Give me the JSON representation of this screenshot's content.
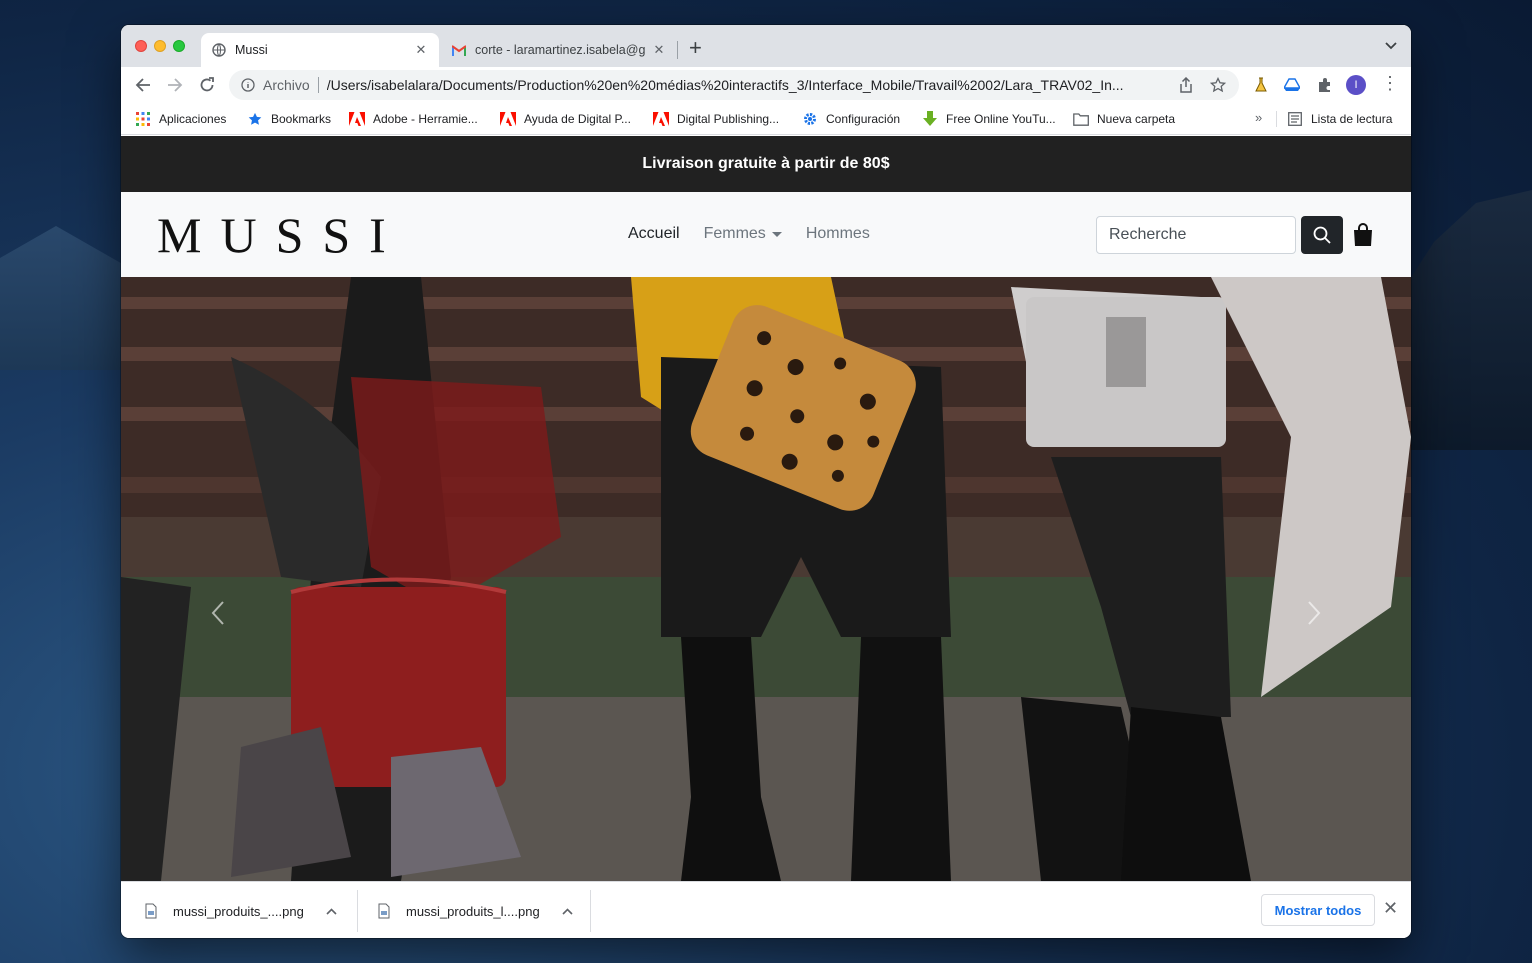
{
  "browser": {
    "tabs": [
      {
        "title": "Mussi",
        "icon": "globe-icon"
      },
      {
        "title": "corte - laramartinez.isabela@g",
        "icon": "gmail-icon"
      }
    ],
    "address": {
      "scheme": "Archivo",
      "url": "/Users/isabelalara/Documents/Production%20en%20médias%20interactifs_3/Interface_Mobile/Travail%2002/Lara_TRAV02_In..."
    },
    "bookmarks": [
      {
        "label": "Aplicaciones",
        "icon": "apps-grid-icon"
      },
      {
        "label": "Bookmarks",
        "icon": "star-icon"
      },
      {
        "label": "Adobe - Herramie...",
        "icon": "adobe-icon"
      },
      {
        "label": "Ayuda de Digital P...",
        "icon": "adobe-icon"
      },
      {
        "label": "Digital Publishing...",
        "icon": "adobe-icon"
      },
      {
        "label": "Configuración",
        "icon": "gear-icon"
      },
      {
        "label": "Free Online YouTu...",
        "icon": "download-arrow-icon"
      },
      {
        "label": "Nueva carpeta",
        "icon": "folder-icon"
      }
    ],
    "reading_list": "Lista de lectura",
    "avatar_initial": "I"
  },
  "site": {
    "promo": "Livraison gratuite à partir de 80$",
    "brand": "MUSSI",
    "nav": [
      {
        "label": "Accueil",
        "active": true
      },
      {
        "label": "Femmes",
        "dropdown": true
      },
      {
        "label": "Hommes"
      }
    ],
    "search_placeholder": "Recherche"
  },
  "downloads": {
    "items": [
      {
        "filename": "mussi_produits_....png"
      },
      {
        "filename": "mussi_produits_l....png"
      }
    ],
    "show_all": "Mostrar todos"
  },
  "colors": {
    "promo_bg": "#212121",
    "navbar_bg": "#f8f9fa",
    "search_btn_bg": "#212529",
    "link_blue": "#1a73e8"
  }
}
